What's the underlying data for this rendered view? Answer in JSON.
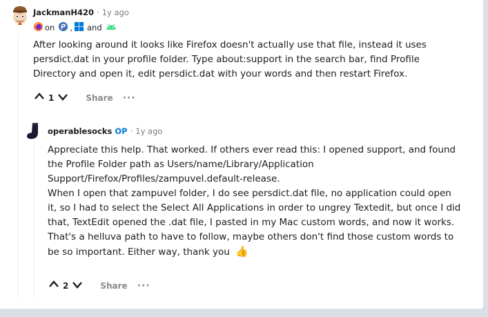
{
  "comments": [
    {
      "username": "JackmanH420",
      "time": "1y ago",
      "flair": {
        "icons": [
          "firefox-icon",
          "fedora-icon",
          "windows-icon",
          "android-icon"
        ],
        "on_text": "on",
        "comma": ",",
        "and_text": "and"
      },
      "body": "After looking around it looks like Firefox doesn't actually use that file, instead it uses\npersdict.dat in your profile folder. Type about:support in the search bar, find Profile\nDirectory and open it, edit persdict.dat with your words and then restart Firefox.",
      "votes": "1",
      "share_label": "Share",
      "more_label": "···"
    },
    {
      "username": "operablesocks",
      "op_badge": "OP",
      "time": "1y ago",
      "body_p1": "Appreciate this help. That worked. If others ever read this: I opened support, and found\nthe Profile Folder path as Users/name/Library/Application\nSupport/Firefox/Profiles/zampuvel.default-release.",
      "body_p2": "When I open that zampuvel folder, I do see persdict.dat file, no application could open\nit, so I had to select the Select All Applications in order to ungrey Textedit, but once I did\nthat, TextEdit opened the .dat file, I pasted in my Mac custom words, and now it works.\nThat's a helluva path to have to follow, maybe others don't find those custom words to\nbe so important. Either way, thank you",
      "emoji": "👍",
      "votes": "2",
      "share_label": "Share",
      "more_label": "···"
    }
  ],
  "colors": {
    "accent": "#0079d3",
    "meta": "#7c7c7c",
    "action": "#878a8c",
    "background": "#dae0e6"
  }
}
